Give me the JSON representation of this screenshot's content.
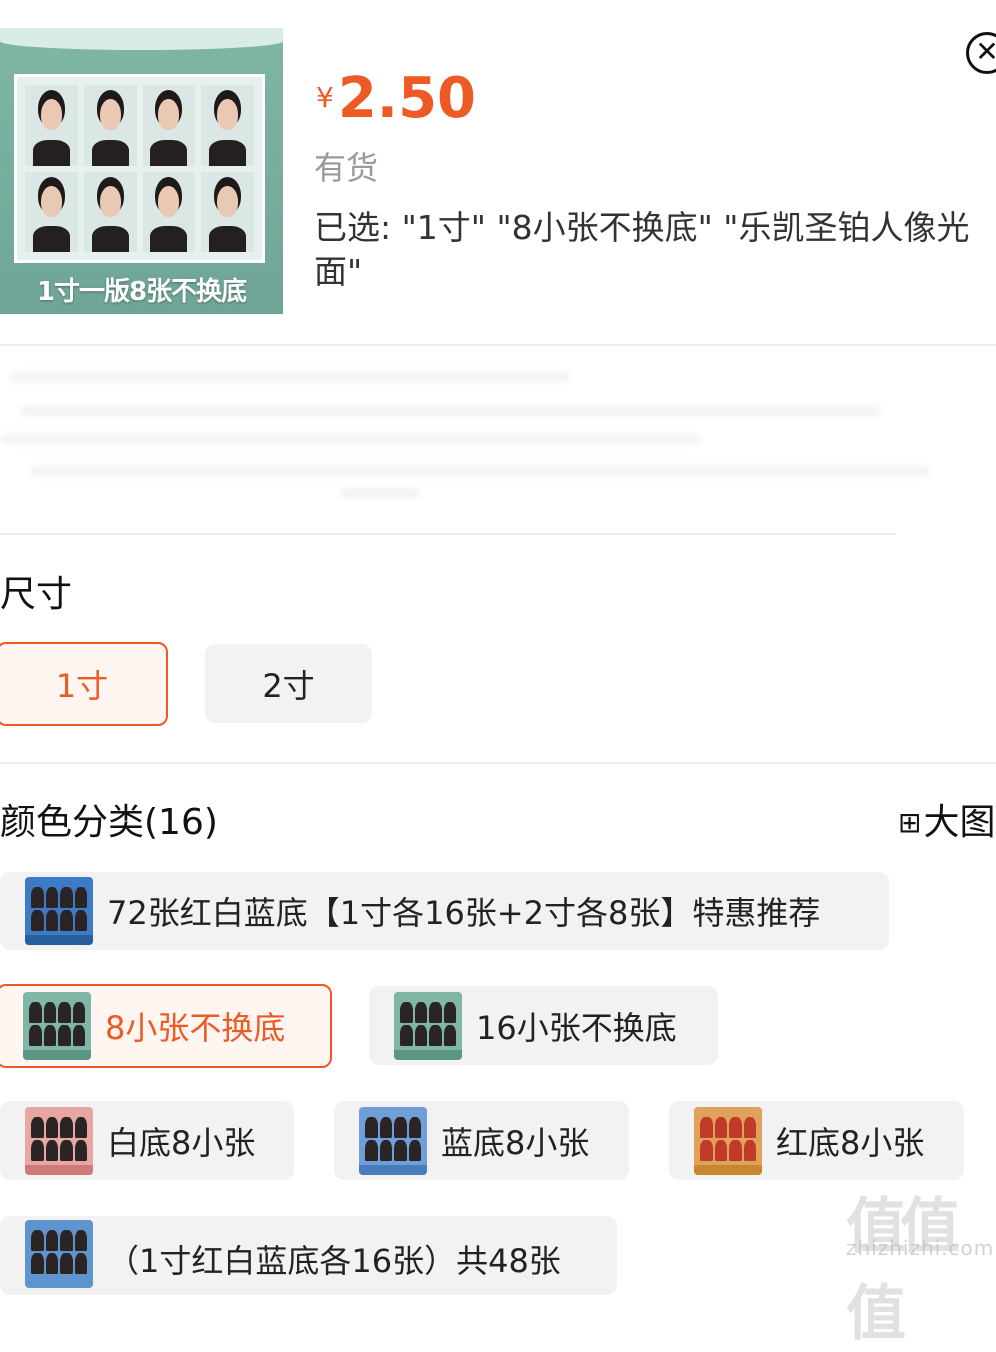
{
  "header": {
    "thumbnail_caption": "1寸一版8张不换底",
    "currency": "¥",
    "price": "2.50",
    "stock_status": "有货",
    "selected_text": "已选: \"1寸\" \"8小张不换底\" \"乐凯圣铂人像光面\"",
    "close_icon": "close-icon"
  },
  "size_section": {
    "title": "尺寸",
    "options": [
      {
        "label": "1寸",
        "selected": true
      },
      {
        "label": "2寸",
        "selected": false
      }
    ]
  },
  "color_section": {
    "title": "颜色分类(16)",
    "big_image_label": "大图",
    "big_image_icon": "grid-view-icon",
    "options": [
      {
        "label": "72张红白蓝底【1寸各16张+2寸各8张】特惠推荐",
        "selected": false
      },
      {
        "label": "8小张不换底",
        "selected": true
      },
      {
        "label": "16小张不换底",
        "selected": false
      },
      {
        "label": "白底8小张",
        "selected": false
      },
      {
        "label": "蓝底8小张",
        "selected": false
      },
      {
        "label": "红底8小张",
        "selected": false
      },
      {
        "label": "（1寸红白蓝底各16张）共48张",
        "selected": false
      }
    ]
  },
  "watermark": {
    "logo_text": "值值值",
    "domain_text": "zhizhizhi.com"
  },
  "colors": {
    "accent": "#ee5a24",
    "chip_bg": "#f2f2f2",
    "selected_bg": "#fff5f1"
  }
}
